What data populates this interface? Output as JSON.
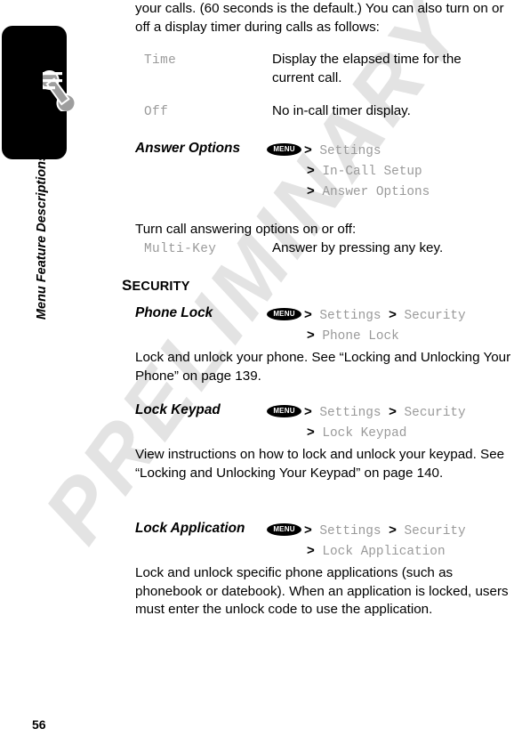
{
  "page": {
    "number": "56",
    "watermark": "PRELIMINARY",
    "sidebar_title": "Menu Feature Descriptions",
    "phone_icon": "phone-handset-icon"
  },
  "intro": {
    "paragraph": "your calls. (60 seconds is the default.) You can also turn on or off a display timer during calls as follows:"
  },
  "timer_options": [
    {
      "term": "Time",
      "definition": "Display the elapsed time for the current call."
    },
    {
      "term": "Off",
      "definition": "No in-call timer display."
    }
  ],
  "answer_options": {
    "name": "Answer Options",
    "menu_key_label": "MENU",
    "nav": [
      {
        "gt": ">",
        "item": "Settings"
      },
      {
        "gt": ">",
        "item": "In-Call Setup"
      },
      {
        "gt": ">",
        "item": "Answer Options"
      }
    ],
    "description": "Turn call answering options on or off:",
    "options": [
      {
        "term": "Multi-Key",
        "definition": "Answer by pressing any key."
      }
    ]
  },
  "security_section": {
    "heading_cap": "S",
    "heading_rest": "ECURITY",
    "heading_full": "SECURITY",
    "entries": [
      {
        "name": "Phone Lock",
        "menu_key_label": "MENU",
        "nav_line1": "> Settings > Security",
        "nav_line1_parts": {
          "gt1": ">",
          "item1": "Settings",
          "gt2": ">",
          "item2": "Security"
        },
        "nav_line2_gt": ">",
        "nav_line2_item": "Phone Lock",
        "body": "Lock and unlock your phone. See “Locking and Unlocking Your Phone” on page 139."
      },
      {
        "name": "Lock Keypad",
        "menu_key_label": "MENU",
        "nav_line1_parts": {
          "gt1": ">",
          "item1": "Settings",
          "gt2": ">",
          "item2": "Security"
        },
        "nav_line2_gt": ">",
        "nav_line2_item": "Lock Keypad",
        "body": "View instructions on how to lock and unlock your keypad. See “Locking and Unlocking Your Keypad” on page 140."
      },
      {
        "name": "Lock Application",
        "menu_key_label": "MENU",
        "nav_line1_parts": {
          "gt1": ">",
          "item1": "Settings",
          "gt2": ">",
          "item2": "Security"
        },
        "nav_line2_gt": ">",
        "nav_line2_item": "Lock Application",
        "body": "Lock and unlock specific phone applications (such as phonebook or datebook). When an application is locked, users must enter the unlock code to use the application."
      }
    ]
  },
  "colors": {
    "mono_gray": "#9a9a9a",
    "watermark_gray": "#e3e3e3",
    "badge_black": "#000000",
    "handset_gray": "#9e9e9e"
  }
}
